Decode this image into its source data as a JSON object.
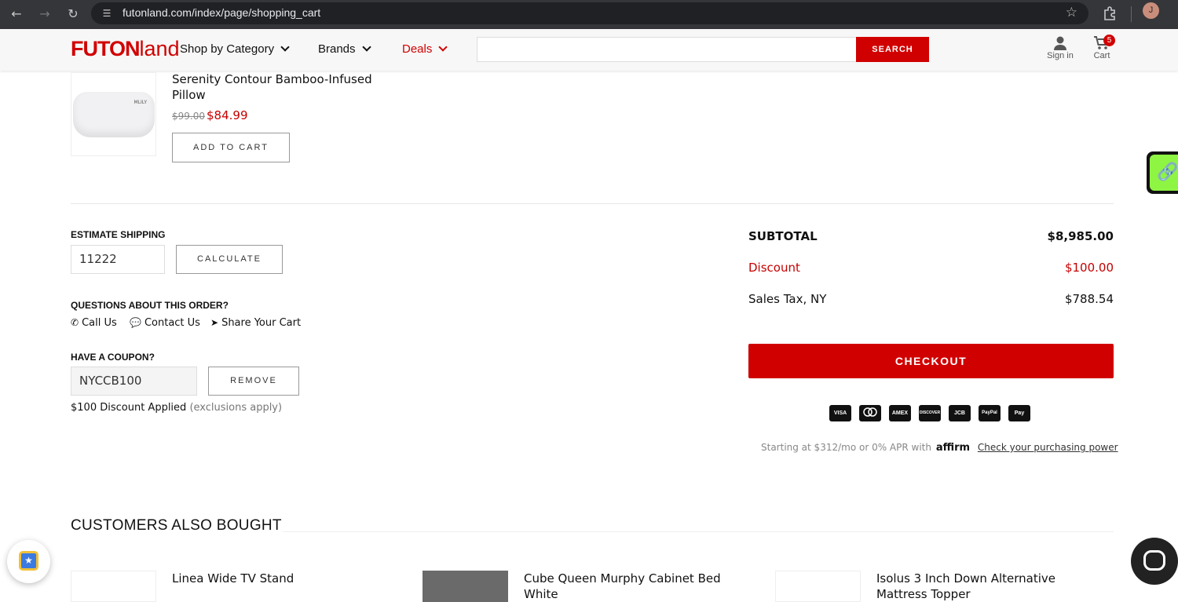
{
  "browser": {
    "url": "futonland.com/index/page/shopping_cart",
    "profile_initial": "J",
    "icons": [
      "back-icon",
      "forward-icon",
      "reload-icon",
      "site-settings-icon",
      "star-icon",
      "extensions-icon"
    ]
  },
  "header": {
    "logo_bold": "FUTON",
    "logo_thin": "land",
    "menu": {
      "shop_by_category": "Shop by Category",
      "brands": "Brands",
      "deals": "Deals"
    },
    "search": {
      "placeholder": "",
      "button_label": "SEARCH"
    },
    "sign_in_label": "Sign in",
    "cart_label": "Cart",
    "cart_count": "5"
  },
  "product": {
    "name": "Serenity Contour Bamboo-Infused Pillow",
    "image_brand": "MLILY",
    "old_price": "$99.00",
    "new_price": "$84.99",
    "add_to_cart_label": "ADD TO CART"
  },
  "shipping": {
    "heading": "ESTIMATE SHIPPING",
    "zip_value": "11222",
    "calculate_label": "CALCULATE"
  },
  "questions": {
    "heading": "QUESTIONS ABOUT THIS ORDER?",
    "call_us": "Call Us",
    "contact_us": "Contact Us",
    "share_cart": "Share Your Cart"
  },
  "coupon": {
    "heading": "HAVE A COUPON?",
    "code_value": "NYCCB100",
    "remove_label": "REMOVE",
    "applied_text": "$100 Discount Applied",
    "exclusions_text": "(exclusions apply)"
  },
  "totals": {
    "subtotal_label": "SUBTOTAL",
    "subtotal_value": "$8,985.00",
    "discount_label": "Discount",
    "discount_value": "$100.00",
    "tax_label": "Sales Tax, NY",
    "tax_value": "$788.54",
    "checkout_label": "CHECKOUT"
  },
  "payment_methods": [
    "VISA",
    "MC",
    "AMEX",
    "DISCOVER",
    "JCB",
    "PayPal",
    "Pay"
  ],
  "affirm": {
    "text": "Starting at $312/mo or 0% APR with",
    "brand": "affirm",
    "link": "Check your purchasing power"
  },
  "also_bought": {
    "title": "CUSTOMERS ALSO BOUGHT",
    "items": [
      {
        "name": "Linea Wide TV Stand"
      },
      {
        "name": "Cube Queen Murphy Cabinet Bed White"
      },
      {
        "name": "Isolus 3 Inch Down Alternative Mattress Topper"
      }
    ]
  },
  "colors": {
    "brand_red": "#d10000",
    "price_red": "#c50000",
    "chrome_dark": "#35363a",
    "widget_green": "#8ef542"
  }
}
